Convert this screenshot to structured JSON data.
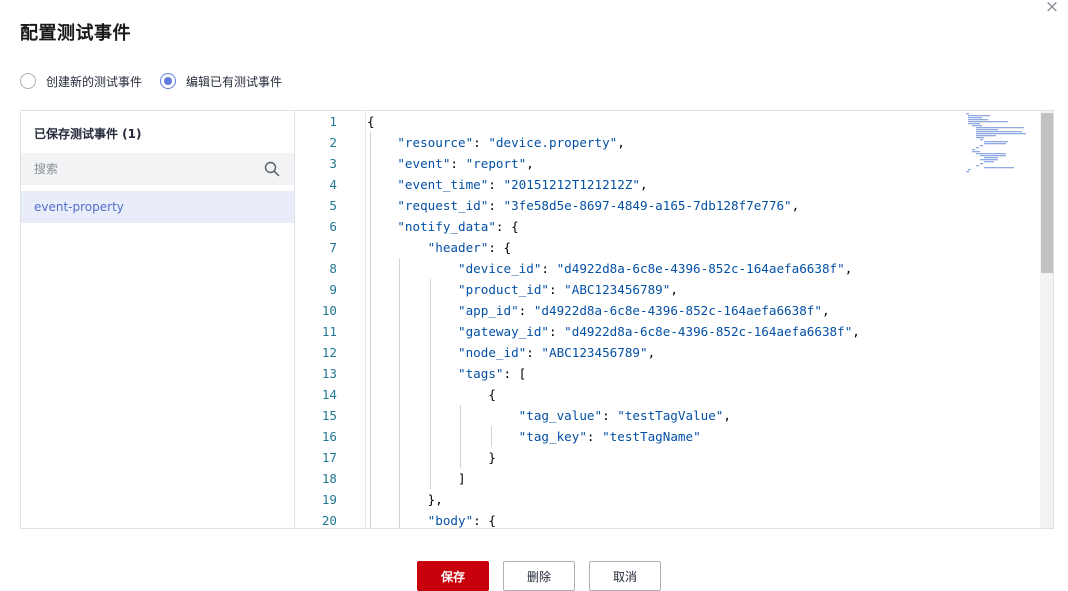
{
  "dialog": {
    "title": "配置测试事件",
    "close_icon": "×"
  },
  "mode": {
    "options": [
      {
        "label": "创建新的测试事件",
        "checked": false
      },
      {
        "label": "编辑已有测试事件",
        "checked": true
      }
    ]
  },
  "sidebar": {
    "title": "已保存测试事件 (1)",
    "search_placeholder": "搜索",
    "items": [
      {
        "label": "event-property",
        "selected": true
      }
    ]
  },
  "editor": {
    "lines": [
      {
        "n": "1",
        "text": "{"
      },
      {
        "n": "2",
        "text": "    \"resource\": \"device.property\","
      },
      {
        "n": "3",
        "text": "    \"event\": \"report\","
      },
      {
        "n": "4",
        "text": "    \"event_time\": \"20151212T121212Z\","
      },
      {
        "n": "5",
        "text": "    \"request_id\": \"3fe58d5e-8697-4849-a165-7db128f7e776\","
      },
      {
        "n": "6",
        "text": "    \"notify_data\": {"
      },
      {
        "n": "7",
        "text": "        \"header\": {"
      },
      {
        "n": "8",
        "text": "            \"device_id\": \"d4922d8a-6c8e-4396-852c-164aefa6638f\","
      },
      {
        "n": "9",
        "text": "            \"product_id\": \"ABC123456789\","
      },
      {
        "n": "10",
        "text": "            \"app_id\": \"d4922d8a-6c8e-4396-852c-164aefa6638f\","
      },
      {
        "n": "11",
        "text": "            \"gateway_id\": \"d4922d8a-6c8e-4396-852c-164aefa6638f\","
      },
      {
        "n": "12",
        "text": "            \"node_id\": \"ABC123456789\","
      },
      {
        "n": "13",
        "text": "            \"tags\": ["
      },
      {
        "n": "14",
        "text": "                {"
      },
      {
        "n": "15",
        "text": "                    \"tag_value\": \"testTagValue\","
      },
      {
        "n": "16",
        "text": "                    \"tag_key\": \"testTagName\""
      },
      {
        "n": "17",
        "text": "                }"
      },
      {
        "n": "18",
        "text": "            ]"
      },
      {
        "n": "19",
        "text": "        },"
      },
      {
        "n": "20",
        "text": "        \"body\": {"
      }
    ]
  },
  "buttons": {
    "save": "保存",
    "delete": "删除",
    "cancel": "取消"
  },
  "colors": {
    "primary": "#c7000b",
    "accent": "#5e7ce0",
    "json_string": "#0451a5",
    "line_number": "#237893"
  }
}
